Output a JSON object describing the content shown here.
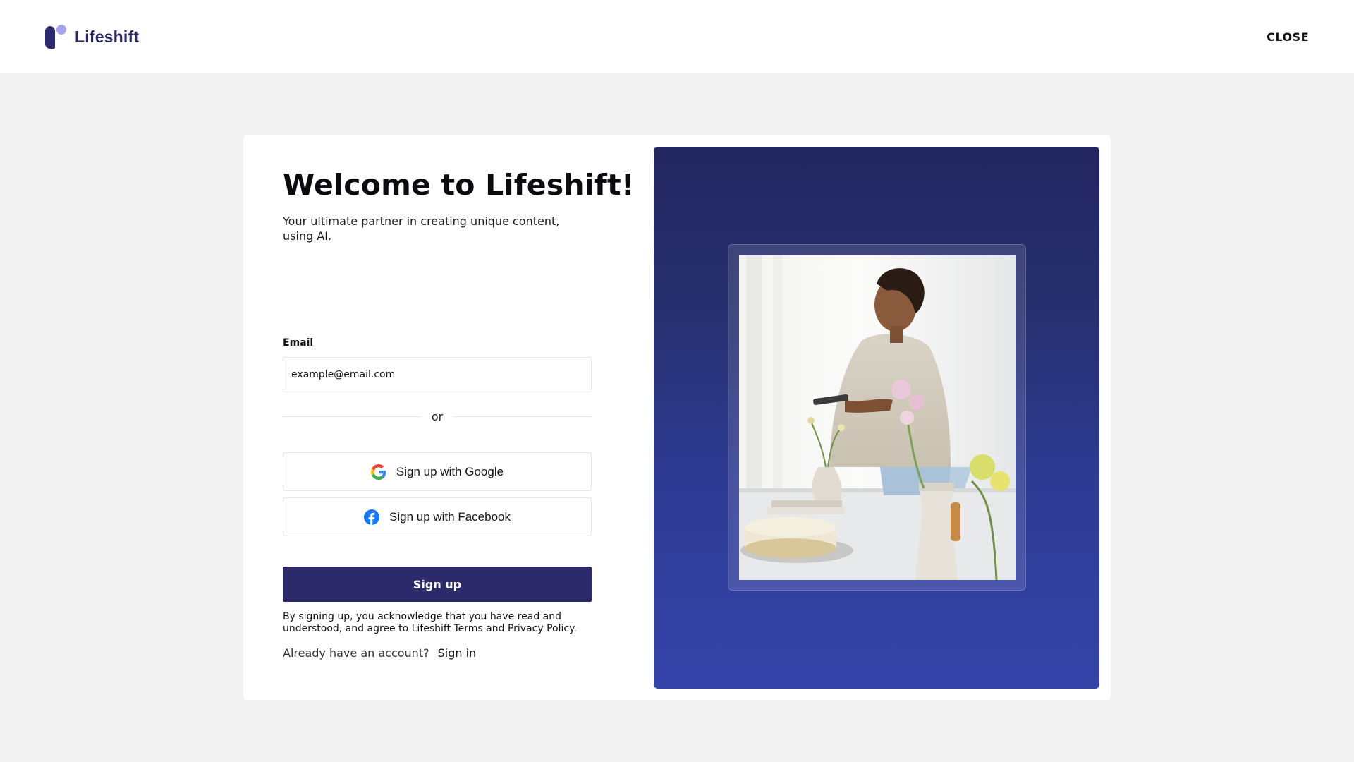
{
  "header": {
    "brand_name": "Lifeshift",
    "close_label": "CLOSE"
  },
  "form": {
    "title": "Welcome to Lifeshift!",
    "subtitle": "Your ultimate partner in creating unique content, using AI.",
    "email_label": "Email",
    "email_placeholder": "example@email.com",
    "divider_text": "or",
    "google_label": "Sign up with Google",
    "facebook_label": "Sign up with Facebook",
    "signup_label": "Sign up",
    "legal_text": "By signing up, you acknowledge that you have read and understood, and agree to Lifeshift Terms and Privacy Policy.",
    "signin_prompt": "Already have an account?",
    "signin_label": "Sign in"
  },
  "icons": {
    "brand": "lifeshift-logo-icon",
    "google": "google-icon",
    "facebook": "facebook-icon"
  },
  "colors": {
    "accent": "#2c2a6b",
    "brand_text": "#2a2a5c",
    "logo_dot": "#a9a4f0",
    "hero_gradient_top": "#222660",
    "hero_gradient_bottom": "#3443a8",
    "facebook_blue": "#1877f2",
    "page_background": "#f2f2f2"
  }
}
